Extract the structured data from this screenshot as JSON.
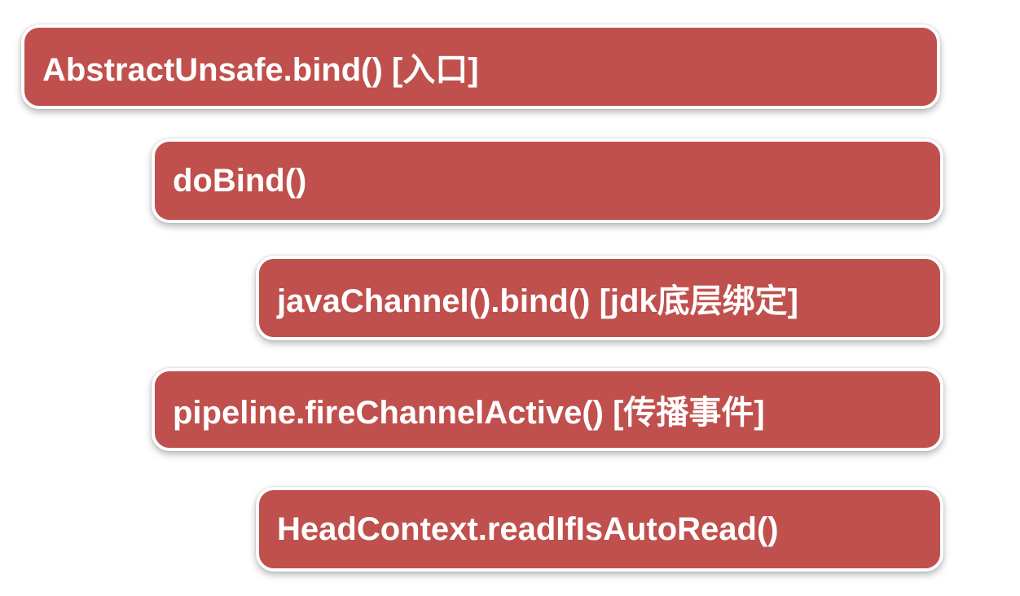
{
  "diagram": {
    "accent_color": "#c0504d",
    "steps": [
      {
        "label": "AbstractUnsafe.bind() [入口]"
      },
      {
        "label": "doBind()"
      },
      {
        "label": "javaChannel().bind() [jdk底层绑定]"
      },
      {
        "label": "pipeline.fireChannelActive() [传播事件]"
      },
      {
        "label": "HeadContext.readIfIsAutoRead()"
      }
    ]
  }
}
